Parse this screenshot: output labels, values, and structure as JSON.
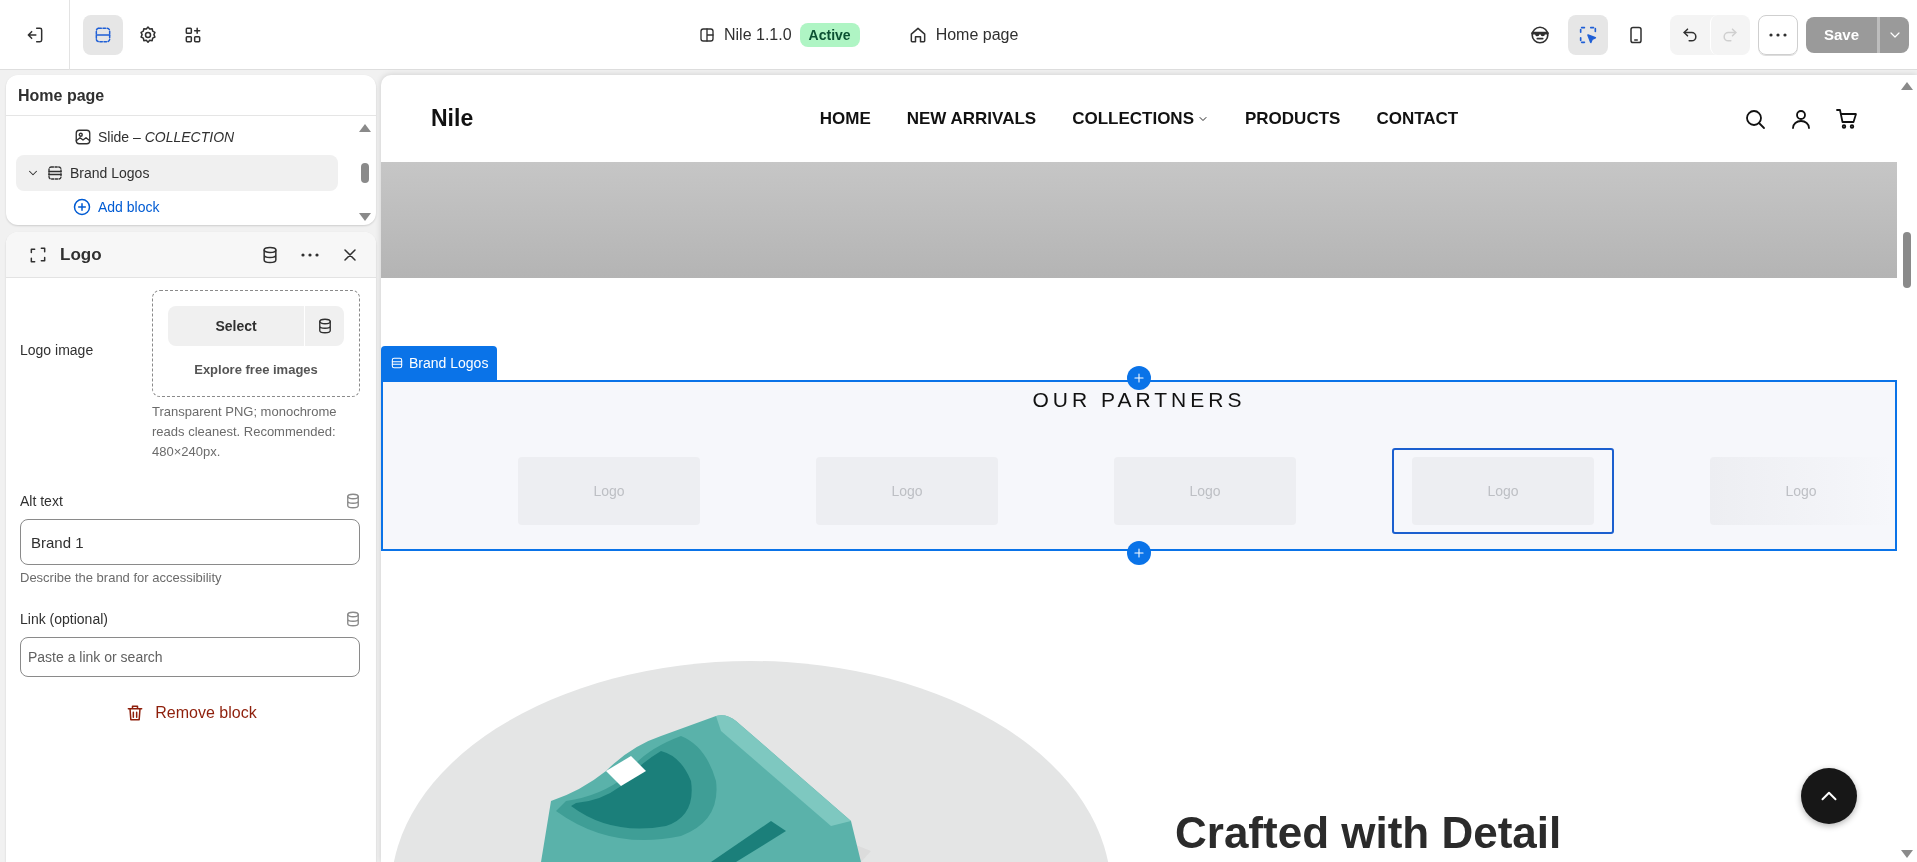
{
  "topbar": {
    "tools": [
      {
        "kind": "sections",
        "selected": true
      },
      {
        "kind": "settings",
        "selected": false
      },
      {
        "kind": "apps",
        "selected": false
      }
    ],
    "theme": {
      "name": "Nile 1.1.0",
      "status": "Active"
    },
    "page": "Home page",
    "view_tools": [
      {
        "kind": "inspector",
        "selected": false
      },
      {
        "kind": "select",
        "selected": true
      },
      {
        "kind": "mobile",
        "selected": false
      }
    ],
    "history": [
      {
        "kind": "undo",
        "disabled": false
      },
      {
        "kind": "redo",
        "disabled": true
      }
    ],
    "save": {
      "label": "Save",
      "disabled": true
    }
  },
  "sidebar": {
    "title": "Home page",
    "tree": [
      {
        "kind": "block",
        "label": "Slide – *COLLECTION*",
        "selected": false
      },
      {
        "kind": "section",
        "label": "Brand Logos",
        "selected": true,
        "expanded": true
      },
      {
        "kind": "add",
        "label": "Add block"
      }
    ]
  },
  "settings": {
    "title": "Logo",
    "logo_image": {
      "label": "Logo image",
      "select": "Select",
      "explore": "Explore free images",
      "help": "Transparent PNG; monochrome reads cleanest. Recommended: 480×240px."
    },
    "alt_text": {
      "label": "Alt text",
      "value": "Brand 1",
      "help": "Describe the brand for accessibility"
    },
    "link": {
      "label": "Link (optional)",
      "placeholder": "Paste a link or search"
    },
    "remove": "Remove block"
  },
  "preview": {
    "store": "Nile",
    "nav": [
      {
        "label": "HOME",
        "dropdown": false
      },
      {
        "label": "NEW ARRIVALS",
        "dropdown": false
      },
      {
        "label": "COLLECTIONS",
        "dropdown": true
      },
      {
        "label": "PRODUCTS",
        "dropdown": false
      },
      {
        "label": "CONTACT",
        "dropdown": false
      }
    ],
    "section_tag": "Brand Logos",
    "heading": "OUR PARTNERS",
    "logos": [
      {
        "label": "Logo",
        "selected": false
      },
      {
        "label": "Logo",
        "selected": false
      },
      {
        "label": "Logo",
        "selected": false
      },
      {
        "label": "Logo",
        "selected": true
      },
      {
        "label": "Logo",
        "selected": false
      }
    ],
    "feature_heading": "Crafted with Detail"
  }
}
